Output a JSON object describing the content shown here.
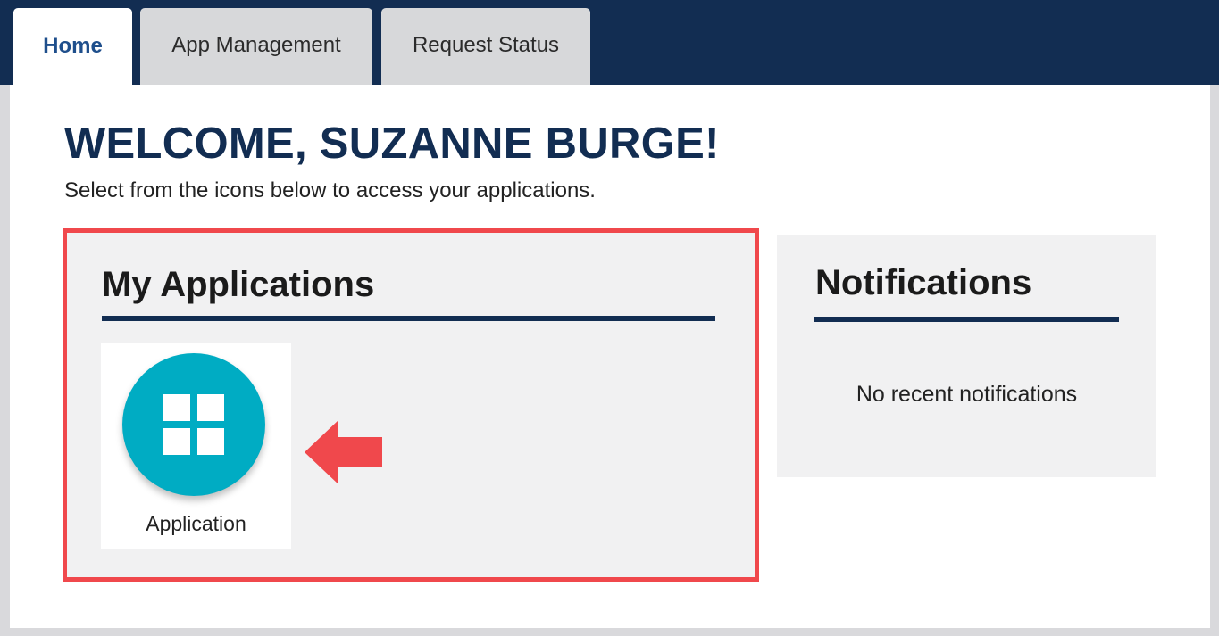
{
  "tabs": [
    {
      "label": "Home",
      "active": true
    },
    {
      "label": "App Management",
      "active": false
    },
    {
      "label": "Request Status",
      "active": false
    }
  ],
  "header": {
    "welcome": "WELCOME, SUZANNE BURGE!",
    "subtitle": "Select from the icons below to access your applications."
  },
  "my_applications": {
    "title": "My Applications",
    "apps": [
      {
        "label": "Application",
        "icon": "grid-icon"
      }
    ]
  },
  "notifications": {
    "title": "Notifications",
    "empty_message": "No recent notifications"
  },
  "colors": {
    "navy": "#122d52",
    "active_tab_text": "#1f4f8c",
    "tab_inactive": "#d7d8da",
    "app_circle": "#00acc3",
    "highlight_red": "#f0484c",
    "panel_bg": "#f1f1f2"
  }
}
